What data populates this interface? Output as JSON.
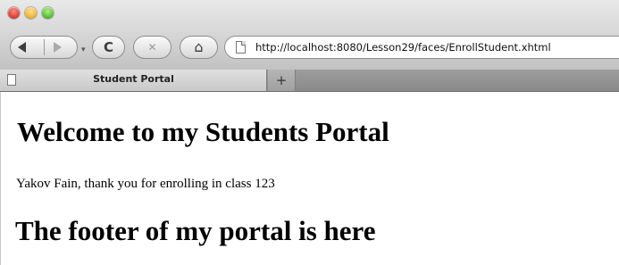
{
  "browser": {
    "tab_title": "Student Portal",
    "new_tab_label": "+",
    "address": {
      "url": "http://localhost:8080/Lesson29/faces/EnrollStudent.xhtml"
    },
    "toolbar": {
      "back_icon": "back-arrow-icon",
      "forward_icon": "forward-arrow-icon",
      "reload_icon": "reload-icon",
      "stop_icon": "stop-icon",
      "home_icon": "home-icon",
      "reload_glyph": "C",
      "stop_glyph": "✕",
      "home_glyph": "⌂"
    }
  },
  "page": {
    "heading": "Welcome to my Students Portal",
    "message": "Yakov Fain, thank you for enrolling in class 123",
    "footer_heading": "The footer of my portal is here"
  }
}
